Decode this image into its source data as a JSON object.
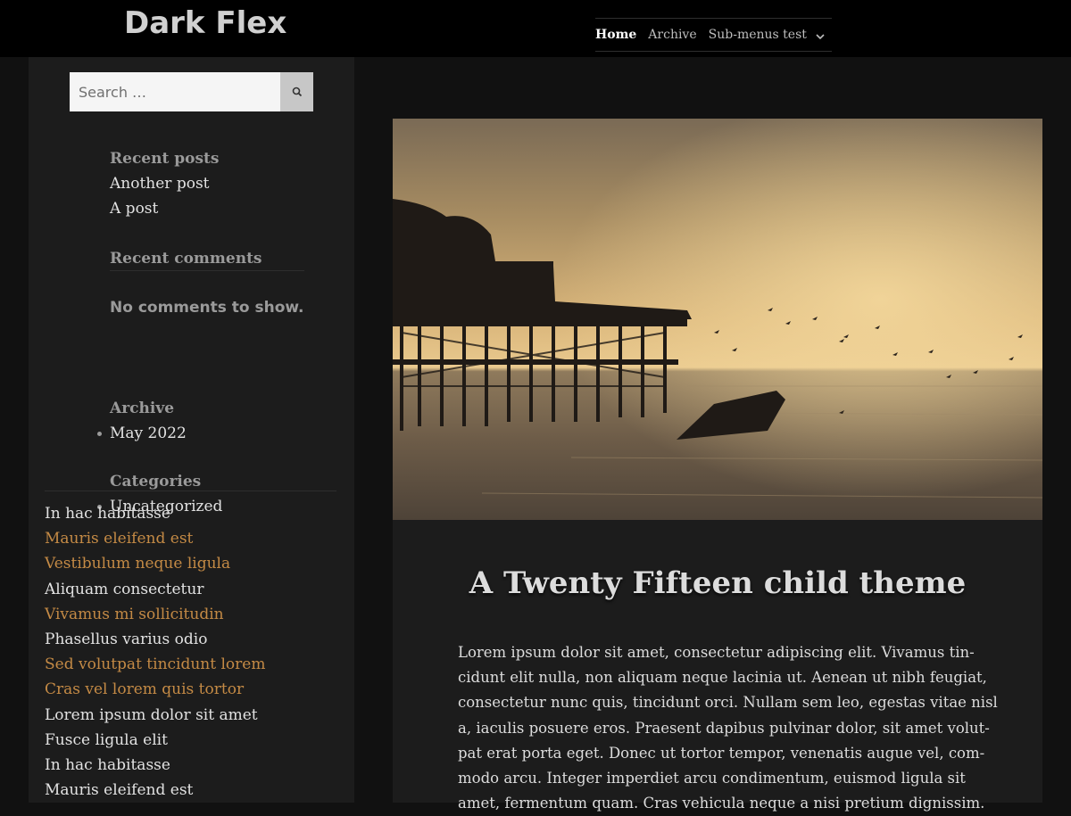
{
  "site": {
    "title": "Dark Flex"
  },
  "nav": {
    "items": [
      "Home",
      "Archive",
      "Sub-menus test"
    ],
    "current": "Home",
    "chevron_icon": "chevron-down-icon"
  },
  "search": {
    "placeholder": "Search …",
    "button_icon": "search-icon"
  },
  "widgets": {
    "recent_posts": {
      "title": "Recent posts",
      "items": [
        "Another post",
        "A post"
      ]
    },
    "recent_comments": {
      "title": "Recent comments",
      "empty_text": "No comments to show."
    },
    "archive": {
      "title": "Archive",
      "items": [
        "May 2022"
      ]
    },
    "categories": {
      "title": "Categories",
      "items": [
        "Uncategorized"
      ]
    }
  },
  "menu": {
    "items": [
      {
        "label": "In hac habitasse",
        "color": "#e2e2e2"
      },
      {
        "label": "Mauris eleifend est",
        "color": "#c48a45"
      },
      {
        "label": "Vestibulum neque ligula",
        "color": "#c48a45"
      },
      {
        "label": "Aliquam consectetur",
        "color": "#e2e2e2"
      },
      {
        "label": "Vivamus mi sollicitudin",
        "color": "#c48a45"
      },
      {
        "label": "Phasellus varius odio",
        "color": "#e2e2e2"
      },
      {
        "label": "Sed volutpat tincidunt lorem",
        "color": "#c48a45"
      },
      {
        "label": "Cras vel lorem quis tortor",
        "color": "#c48a45"
      },
      {
        "label": "Lorem ipsum dolor sit amet",
        "color": "#e2e2e2"
      },
      {
        "label": "Fusce ligula elit",
        "color": "#e2e2e2"
      },
      {
        "label": "In hac habitasse",
        "color": "#e2e2e2"
      },
      {
        "label": "Mauris eleifend est",
        "color": "#e2e2e2"
      }
    ]
  },
  "article": {
    "title": "A Twenty Fifteen child theme",
    "body_lines": [
      "Lorem ipsum dolor sit amet, consectetur adipiscing elit. Vivamus tin-",
      "cidunt elit nulla, non aliquam neque lacinia ut. Aenean ut nibh feugiat,",
      "consectetur nunc quis, tincidunt orci. Nullam sem leo, egestas vitae nisl",
      "a, iaculis posuere eros. Praesent dapibus pulvinar dolor, sit amet volut-",
      "pat erat porta eget. Donec ut tortor tempor, venenatis augue vel, com-",
      "modo arcu. Integer imperdiet arcu condimentum, euismod ligula sit",
      "amet, fermentum quam. Cras vehicula neque a nisi pretium dignissim."
    ]
  },
  "colors": {
    "page_bg": "#111111",
    "header_bg": "#000000",
    "panel_bg": "#1c1c1c",
    "link_accent": "#c48a45",
    "text_light": "#e2e2e2",
    "heading_muted": "#9a9a9a"
  }
}
